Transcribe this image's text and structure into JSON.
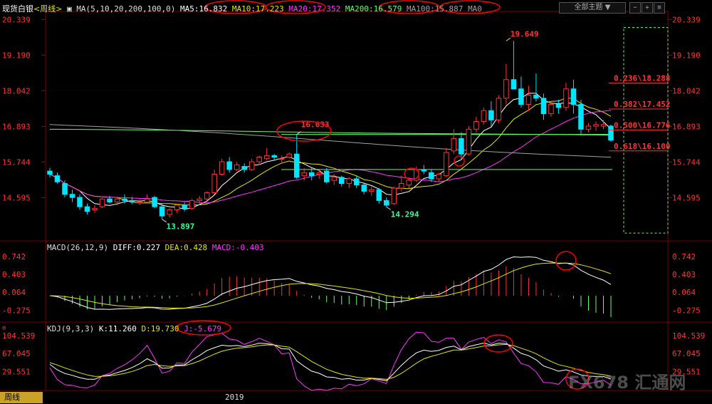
{
  "chart_data": {
    "type": "candlestick",
    "instrument": "现货白银",
    "period": "周线",
    "header": {
      "ma_spec": "MA(5,10,20,200,100,0)",
      "ma5": "MA5:16.832",
      "ma10": "MA10:17.223",
      "ma20": "MA20:17.352",
      "ma200": "MA200:16.579",
      "ma100": "MA100:15.887",
      "ma0": "MA0"
    },
    "price_axis": {
      "ticks": [
        "20.339",
        "19.190",
        "18.042",
        "16.893",
        "15.744",
        "14.595"
      ],
      "range": [
        13.2,
        20.6
      ]
    },
    "x_axis_label": "2019",
    "candles": [
      {
        "o": 15.45,
        "h": 15.55,
        "l": 15.25,
        "c": 15.35
      },
      {
        "o": 15.3,
        "h": 15.4,
        "l": 15.05,
        "c": 15.1
      },
      {
        "o": 15.05,
        "h": 15.15,
        "l": 14.6,
        "c": 14.7
      },
      {
        "o": 14.7,
        "h": 14.85,
        "l": 14.45,
        "c": 14.6
      },
      {
        "o": 14.6,
        "h": 14.7,
        "l": 14.2,
        "c": 14.3
      },
      {
        "o": 14.3,
        "h": 14.4,
        "l": 14.05,
        "c": 14.15
      },
      {
        "o": 14.2,
        "h": 14.35,
        "l": 14.1,
        "c": 14.25
      },
      {
        "o": 14.3,
        "h": 14.6,
        "l": 14.25,
        "c": 14.55
      },
      {
        "o": 14.55,
        "h": 14.65,
        "l": 14.4,
        "c": 14.45
      },
      {
        "o": 14.45,
        "h": 14.6,
        "l": 14.35,
        "c": 14.55
      },
      {
        "o": 14.55,
        "h": 14.7,
        "l": 14.4,
        "c": 14.5
      },
      {
        "o": 14.5,
        "h": 14.62,
        "l": 14.38,
        "c": 14.45
      },
      {
        "o": 14.45,
        "h": 14.55,
        "l": 14.35,
        "c": 14.45
      },
      {
        "o": 14.45,
        "h": 14.7,
        "l": 14.4,
        "c": 14.55
      },
      {
        "o": 14.6,
        "h": 14.65,
        "l": 14.25,
        "c": 14.3
      },
      {
        "o": 14.3,
        "h": 14.4,
        "l": 13.9,
        "c": 14.0
      },
      {
        "o": 14.05,
        "h": 14.25,
        "l": 13.95,
        "c": 14.2
      },
      {
        "o": 14.2,
        "h": 14.4,
        "l": 14.1,
        "c": 14.35
      },
      {
        "o": 14.35,
        "h": 14.45,
        "l": 14.15,
        "c": 14.25
      },
      {
        "o": 14.25,
        "h": 14.55,
        "l": 14.2,
        "c": 14.5
      },
      {
        "o": 14.5,
        "h": 14.65,
        "l": 14.4,
        "c": 14.55
      },
      {
        "o": 14.55,
        "h": 14.8,
        "l": 14.5,
        "c": 14.75
      },
      {
        "o": 14.75,
        "h": 15.5,
        "l": 14.7,
        "c": 15.35
      },
      {
        "o": 15.35,
        "h": 15.85,
        "l": 15.3,
        "c": 15.75
      },
      {
        "o": 15.75,
        "h": 15.9,
        "l": 15.4,
        "c": 15.5
      },
      {
        "o": 15.5,
        "h": 15.75,
        "l": 15.45,
        "c": 15.65
      },
      {
        "o": 15.6,
        "h": 15.7,
        "l": 15.4,
        "c": 15.5
      },
      {
        "o": 15.5,
        "h": 15.85,
        "l": 15.45,
        "c": 15.75
      },
      {
        "o": 15.75,
        "h": 15.95,
        "l": 15.65,
        "c": 15.9
      },
      {
        "o": 15.85,
        "h": 16.2,
        "l": 15.8,
        "c": 15.95
      },
      {
        "o": 15.95,
        "h": 16.0,
        "l": 15.8,
        "c": 15.9
      },
      {
        "o": 15.85,
        "h": 15.95,
        "l": 15.7,
        "c": 15.85
      },
      {
        "o": 15.9,
        "h": 16.05,
        "l": 15.85,
        "c": 16.0
      },
      {
        "o": 16.0,
        "h": 16.63,
        "l": 15.2,
        "c": 15.25
      },
      {
        "o": 15.3,
        "h": 15.55,
        "l": 15.15,
        "c": 15.4
      },
      {
        "o": 15.4,
        "h": 15.55,
        "l": 15.15,
        "c": 15.3
      },
      {
        "o": 15.35,
        "h": 15.5,
        "l": 15.2,
        "c": 15.4
      },
      {
        "o": 15.45,
        "h": 15.55,
        "l": 15.05,
        "c": 15.1
      },
      {
        "o": 15.15,
        "h": 15.35,
        "l": 15.0,
        "c": 15.25
      },
      {
        "o": 15.25,
        "h": 15.3,
        "l": 14.95,
        "c": 15.05
      },
      {
        "o": 15.05,
        "h": 15.25,
        "l": 14.9,
        "c": 15.2
      },
      {
        "o": 15.2,
        "h": 15.3,
        "l": 14.9,
        "c": 15.0
      },
      {
        "o": 15.0,
        "h": 15.05,
        "l": 14.7,
        "c": 14.8
      },
      {
        "o": 14.8,
        "h": 14.95,
        "l": 14.65,
        "c": 14.85
      },
      {
        "o": 14.85,
        "h": 14.9,
        "l": 14.4,
        "c": 14.5
      },
      {
        "o": 14.5,
        "h": 14.6,
        "l": 14.29,
        "c": 14.35
      },
      {
        "o": 14.4,
        "h": 14.95,
        "l": 14.35,
        "c": 14.9
      },
      {
        "o": 14.9,
        "h": 15.3,
        "l": 14.8,
        "c": 15.05
      },
      {
        "o": 15.0,
        "h": 15.25,
        "l": 14.9,
        "c": 15.15
      },
      {
        "o": 15.15,
        "h": 15.6,
        "l": 15.1,
        "c": 15.5
      },
      {
        "o": 15.5,
        "h": 15.65,
        "l": 15.35,
        "c": 15.45
      },
      {
        "o": 15.4,
        "h": 15.5,
        "l": 15.1,
        "c": 15.2
      },
      {
        "o": 15.2,
        "h": 15.4,
        "l": 15.1,
        "c": 15.35
      },
      {
        "o": 15.3,
        "h": 16.2,
        "l": 15.25,
        "c": 16.05
      },
      {
        "o": 16.1,
        "h": 16.8,
        "l": 16.0,
        "c": 16.5
      },
      {
        "o": 16.5,
        "h": 16.7,
        "l": 15.85,
        "c": 16.0
      },
      {
        "o": 16.0,
        "h": 16.9,
        "l": 15.95,
        "c": 16.8
      },
      {
        "o": 16.8,
        "h": 17.2,
        "l": 16.7,
        "c": 17.05
      },
      {
        "o": 17.05,
        "h": 17.5,
        "l": 16.95,
        "c": 17.4
      },
      {
        "o": 17.4,
        "h": 17.7,
        "l": 16.9,
        "c": 17.1
      },
      {
        "o": 17.1,
        "h": 17.9,
        "l": 17.0,
        "c": 17.8
      },
      {
        "o": 17.8,
        "h": 18.9,
        "l": 17.6,
        "c": 18.4
      },
      {
        "o": 18.4,
        "h": 19.65,
        "l": 18.2,
        "c": 18.1
      },
      {
        "o": 18.1,
        "h": 18.5,
        "l": 17.5,
        "c": 17.6
      },
      {
        "o": 17.6,
        "h": 18.2,
        "l": 17.4,
        "c": 17.9
      },
      {
        "o": 17.9,
        "h": 18.6,
        "l": 17.7,
        "c": 17.8
      },
      {
        "o": 17.8,
        "h": 17.95,
        "l": 17.1,
        "c": 17.3
      },
      {
        "o": 17.3,
        "h": 17.7,
        "l": 17.2,
        "c": 17.6
      },
      {
        "o": 17.6,
        "h": 17.75,
        "l": 17.3,
        "c": 17.5
      },
      {
        "o": 17.5,
        "h": 18.3,
        "l": 17.4,
        "c": 18.1
      },
      {
        "o": 18.1,
        "h": 18.4,
        "l": 17.3,
        "c": 17.6
      },
      {
        "o": 17.6,
        "h": 17.75,
        "l": 16.6,
        "c": 16.8
      },
      {
        "o": 16.8,
        "h": 17.0,
        "l": 16.7,
        "c": 16.9
      },
      {
        "o": 16.9,
        "h": 17.05,
        "l": 16.75,
        "c": 16.95
      },
      {
        "o": 16.9,
        "h": 17.1,
        "l": 16.8,
        "c": 16.95
      },
      {
        "o": 16.9,
        "h": 16.95,
        "l": 16.4,
        "c": 16.45
      }
    ],
    "annotations": {
      "high": {
        "label": "19.649",
        "value": 19.649,
        "index": 61
      },
      "swing_high": {
        "label": "16.633",
        "value": 16.633,
        "index": 33
      },
      "low1": {
        "label": "13.897",
        "value": 13.897,
        "index": 15
      },
      "low2": {
        "label": "14.294",
        "value": 14.294,
        "index": 45
      }
    },
    "fibonacci": [
      {
        "label": "0.236\\18.288",
        "value": 18.288
      },
      {
        "label": "0.382\\17.452",
        "value": 17.452
      },
      {
        "label": "0.500\\16.776",
        "value": 16.776
      },
      {
        "label": "0.618\\16.100",
        "value": 16.1
      }
    ],
    "horizontal_levels": [
      16.633,
      15.5
    ],
    "macd": {
      "header": "MACD(26,12,9)",
      "diff": "DIFF:0.227",
      "dea": "DEA:0.428",
      "macd": "MACD:-0.403",
      "ticks": [
        "0.742",
        "0.403",
        "0.064",
        "-0.275"
      ],
      "range": [
        -0.5,
        0.85
      ]
    },
    "kdj": {
      "header": "KDJ(9,3,3)",
      "k": "K:11.260",
      "d": "D:19.730",
      "j": "J:-5.679",
      "ticks": [
        "104.539",
        "67.045",
        "29.551"
      ],
      "range": [
        -10,
        112
      ]
    },
    "colors": {
      "up": "#ff3333",
      "down": "#00e5ff",
      "white_line": "#ffffff",
      "yellow_line": "#e6e600",
      "magenta_line": "#ff33ff",
      "green_line": "#66ff66",
      "gray_line": "#a0a0a0",
      "axis_text": "#ff3333",
      "fib_text": "#ff3333",
      "circle": "#ff0000"
    }
  },
  "ui": {
    "toolbar_select": "全部主题",
    "period_tab": "周线",
    "watermark": "FX678 汇通网"
  }
}
